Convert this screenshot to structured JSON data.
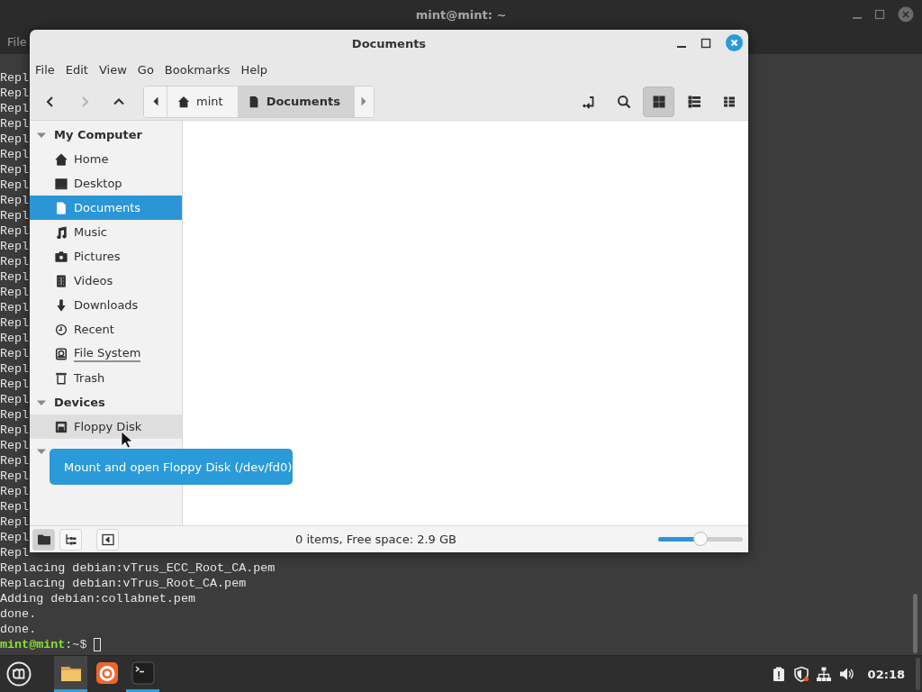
{
  "terminal": {
    "title": "mint@mint: ~",
    "menu": [
      "File"
    ],
    "lines": [
      "Repl",
      "Repl",
      "Repl",
      "Repl",
      "Repl",
      "Repl",
      "Repl",
      "Repl",
      "Repl",
      "Repl",
      "Repl",
      "Repl",
      "Repl",
      "Repl",
      "Repl",
      "Repl",
      "Repl",
      "Repl",
      "Repl",
      "Repl",
      "Repl",
      "Repl",
      "Repl",
      "Repl",
      "Repl",
      "Repl",
      "Repl",
      "Repl",
      "Repl",
      "Repl",
      "Repl",
      "Repl",
      "Replacing debian:vTrus_ECC_Root_CA.pem",
      "Replacing debian:vTrus_Root_CA.pem",
      "Adding debian:collabnet.pem",
      "done.",
      "done."
    ],
    "prompt": {
      "user": "mint@mint",
      "path": ":~$"
    }
  },
  "file_manager": {
    "title": "Documents",
    "menu": [
      "File",
      "Edit",
      "View",
      "Go",
      "Bookmarks",
      "Help"
    ],
    "nav": [
      {
        "kind": "back",
        "disabled": false
      },
      {
        "kind": "forward",
        "disabled": true
      },
      {
        "kind": "up",
        "disabled": false
      }
    ],
    "breadcrumb": [
      {
        "kind": "home",
        "label": "mint",
        "selected": false
      },
      {
        "kind": "folder",
        "label": "Documents",
        "selected": true
      }
    ],
    "tools": [
      {
        "kind": "terminal",
        "selected": false
      },
      {
        "kind": "search",
        "selected": false
      },
      {
        "kind": "icons",
        "selected": true
      },
      {
        "kind": "list",
        "selected": false
      },
      {
        "kind": "compact",
        "selected": false
      }
    ],
    "sidebar": [
      {
        "title": "My Computer",
        "expanded": true,
        "items": [
          {
            "kind": "home",
            "label": "Home",
            "selected": false,
            "hovered": false
          },
          {
            "kind": "desktop",
            "label": "Desktop",
            "selected": false,
            "hovered": false
          },
          {
            "kind": "documents",
            "label": "Documents",
            "selected": true,
            "hovered": false
          },
          {
            "kind": "music",
            "label": "Music",
            "selected": false,
            "hovered": false
          },
          {
            "kind": "pictures",
            "label": "Pictures",
            "selected": false,
            "hovered": false
          },
          {
            "kind": "videos",
            "label": "Videos",
            "selected": false,
            "hovered": false
          },
          {
            "kind": "downloads",
            "label": "Downloads",
            "selected": false,
            "hovered": false
          },
          {
            "kind": "recent",
            "label": "Recent",
            "selected": false,
            "hovered": false
          },
          {
            "kind": "filesystem",
            "label": "File System",
            "selected": false,
            "hovered": false,
            "level": 1.0
          },
          {
            "kind": "trash",
            "label": "Trash",
            "selected": false,
            "hovered": false
          }
        ]
      },
      {
        "title": "Devices",
        "expanded": true,
        "items": [
          {
            "kind": "floppy",
            "label": "Floppy Disk",
            "selected": false,
            "hovered": true
          }
        ]
      },
      {
        "expanded": true
      }
    ],
    "status": {
      "panes": [
        {
          "kind": "places",
          "selected": true
        },
        {
          "kind": "tree",
          "selected": false
        },
        {
          "kind": "toggle",
          "selected": false
        }
      ],
      "text": "0 items, Free space: 2.9 GB",
      "zoom": {
        "level": 0.5
      }
    },
    "tooltip": "Mount and open Floppy Disk (/dev/fd0)"
  },
  "taskbar": {
    "apps": [
      {
        "kind": "files",
        "selected": true,
        "running": true
      },
      {
        "kind": "browser",
        "selected": false,
        "running": false
      },
      {
        "kind": "terminal",
        "selected": false,
        "running": true
      }
    ],
    "tray": [
      {
        "kind": "updates"
      },
      {
        "kind": "shield"
      },
      {
        "kind": "network"
      },
      {
        "kind": "volume"
      }
    ],
    "clock": "02:18"
  }
}
